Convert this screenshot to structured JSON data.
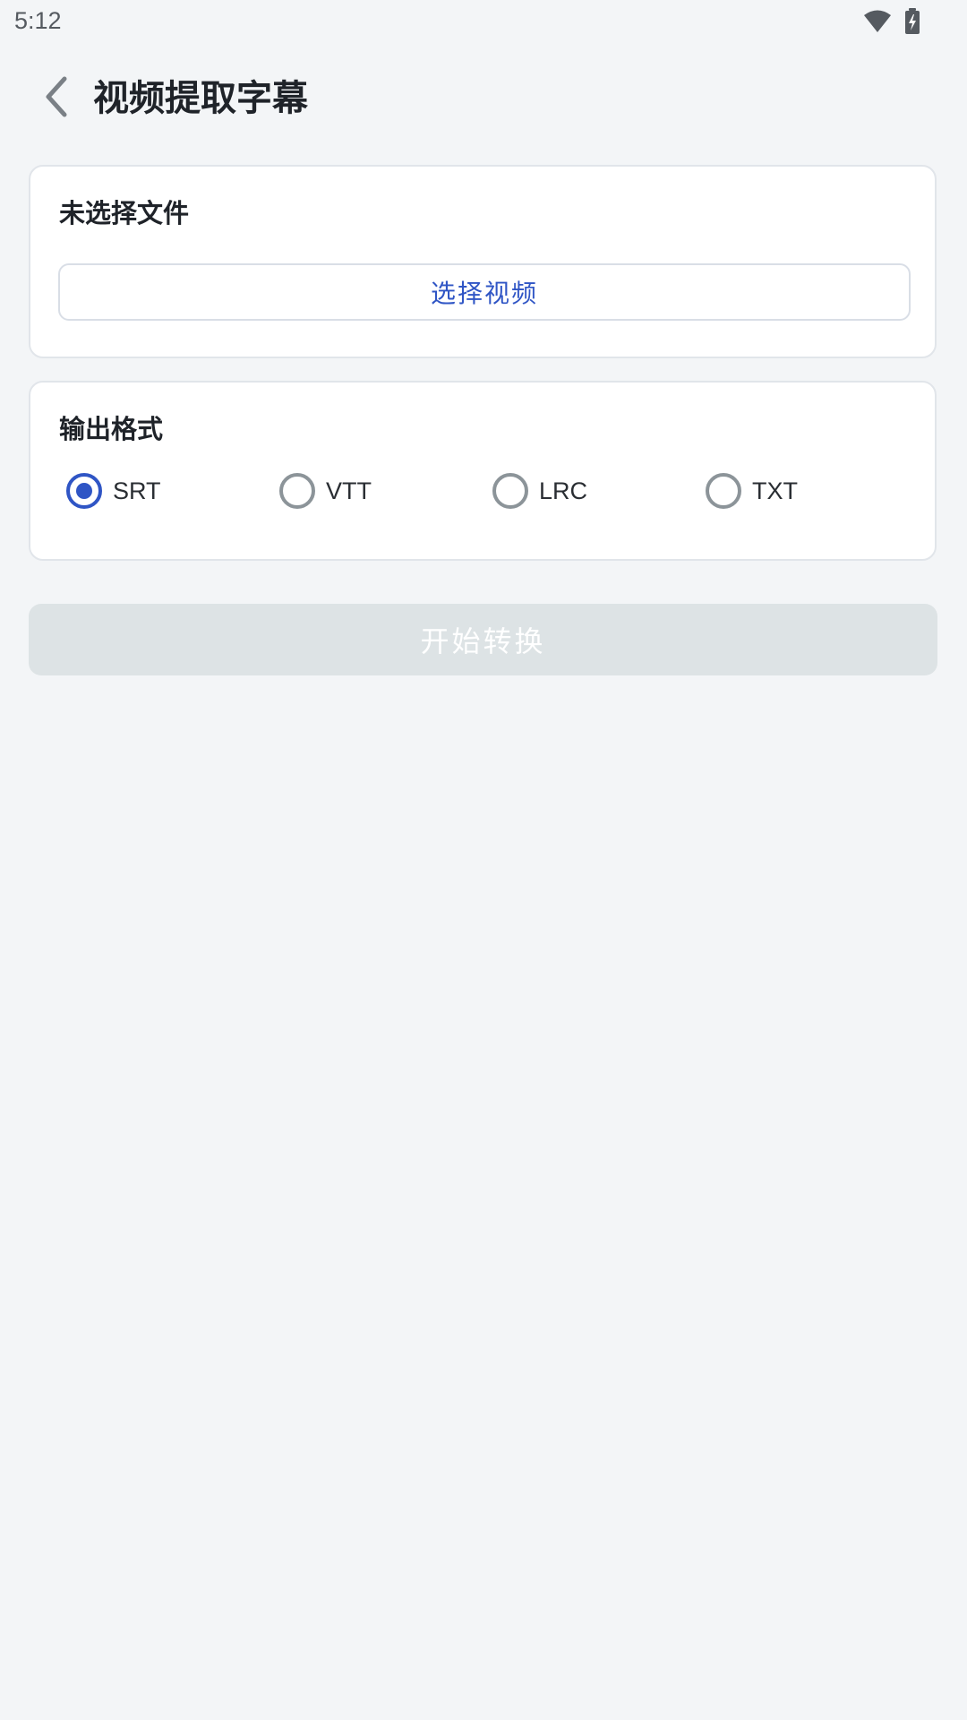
{
  "status_bar": {
    "time": "5:12",
    "icons": [
      "wifi-icon",
      "battery-charging-icon"
    ]
  },
  "header": {
    "back_icon": "chevron-left-icon",
    "title": "视频提取字幕"
  },
  "file_card": {
    "status": "未选择文件",
    "select_button_label": "选择视频"
  },
  "format_card": {
    "title": "输出格式",
    "options": [
      {
        "label": "SRT",
        "selected": true
      },
      {
        "label": "VTT",
        "selected": false
      },
      {
        "label": "LRC",
        "selected": false
      },
      {
        "label": "TXT",
        "selected": false
      }
    ]
  },
  "start_button": {
    "label": "开始转换",
    "enabled": false
  },
  "colors": {
    "accent": "#2f55c5",
    "background": "#f3f5f7",
    "disabled_button": "#dde3e5"
  }
}
